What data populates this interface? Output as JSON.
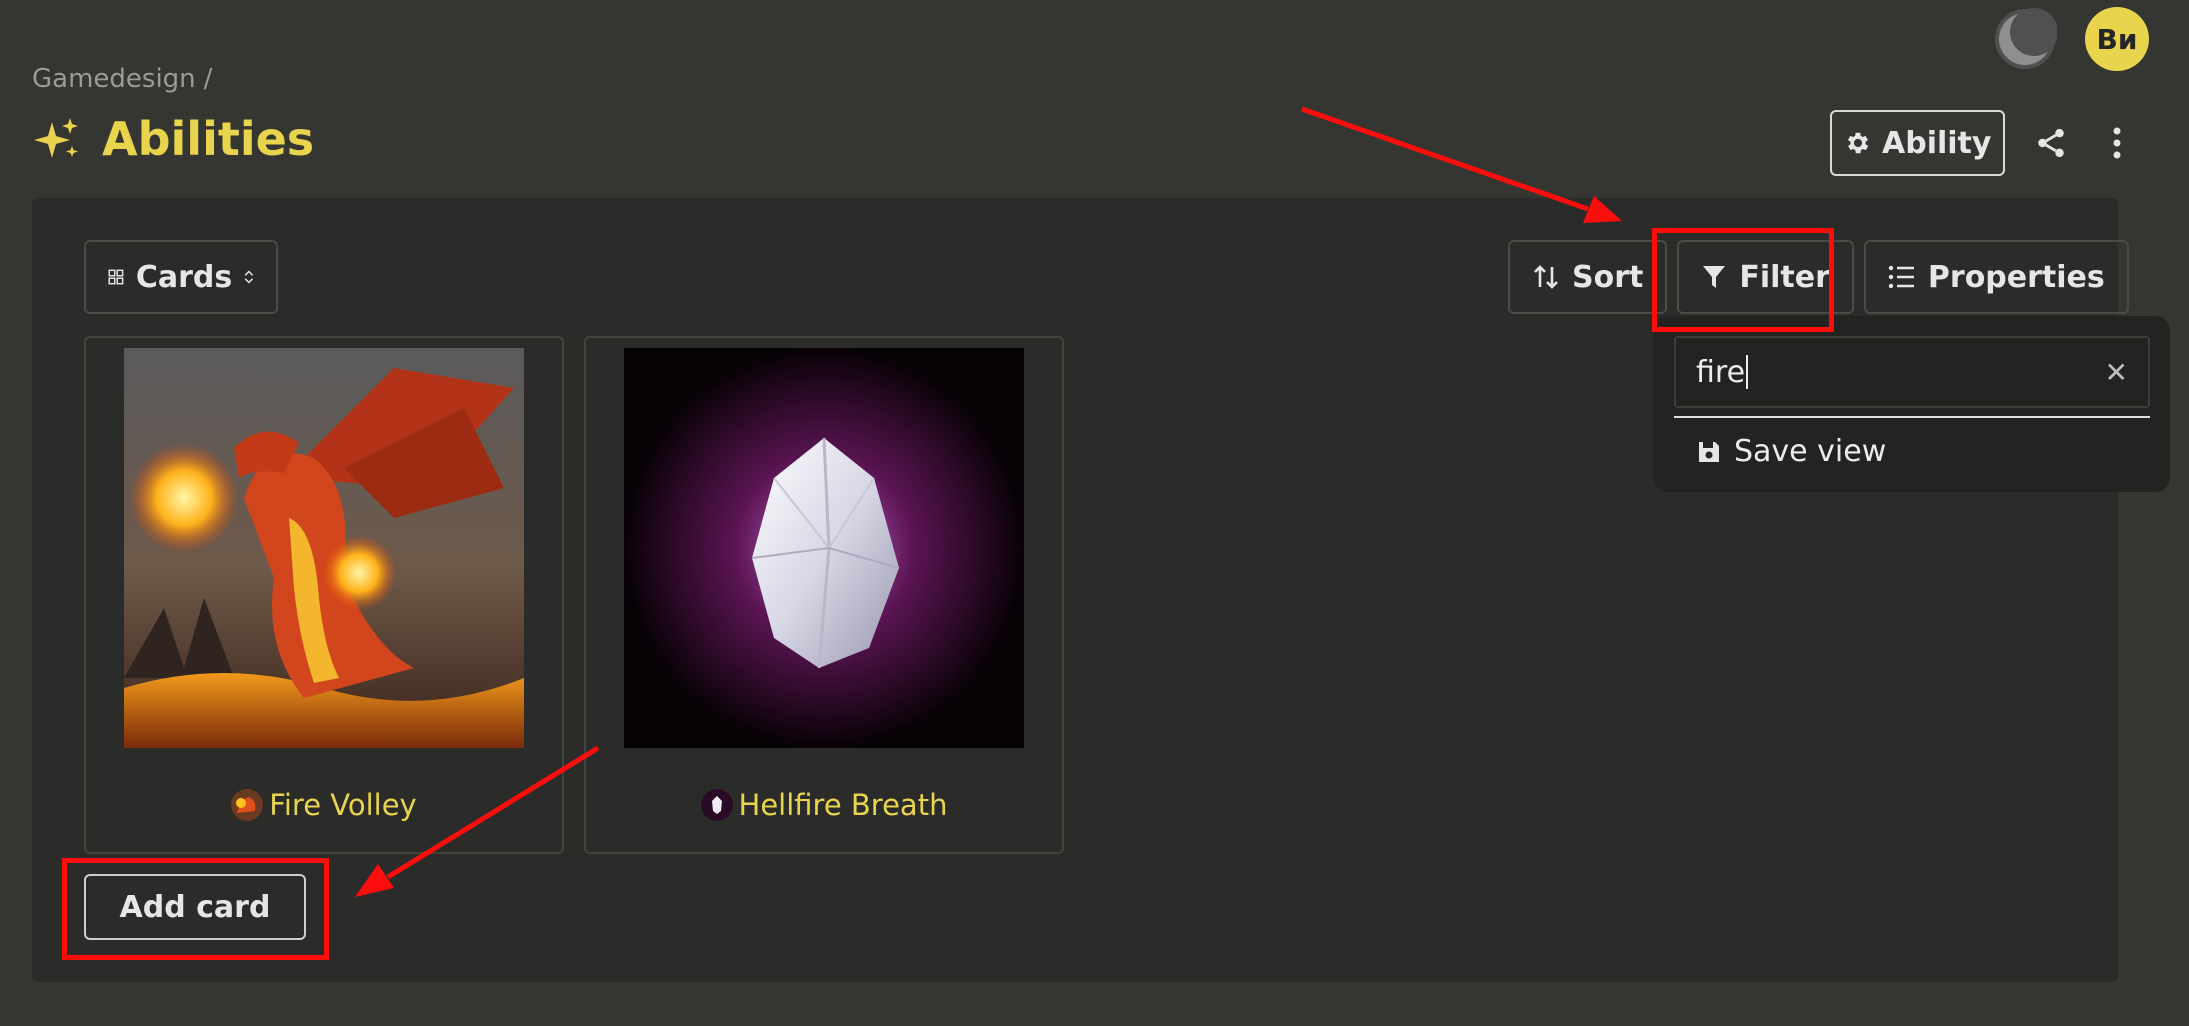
{
  "topbar": {
    "avatar_initials": "Ви"
  },
  "breadcrumb": {
    "parent": "Gamedesign",
    "separator": "/"
  },
  "page": {
    "title": "Abilities",
    "accent_color": "#e8d44d"
  },
  "header_actions": {
    "template_label": "Ability"
  },
  "view": {
    "layout_label": "Cards"
  },
  "toolbar": {
    "sort_label": "Sort",
    "filter_label": "Filter",
    "properties_label": "Properties"
  },
  "cards": [
    {
      "title": "Fire Volley",
      "image": "red fire dragon"
    },
    {
      "title": "Hellfire Breath",
      "image": "glowing crystal"
    }
  ],
  "add_card_label": "Add card",
  "filter_popover": {
    "query": "fire",
    "save_view_label": "Save view"
  },
  "annotation_color": "#ff0d0d"
}
